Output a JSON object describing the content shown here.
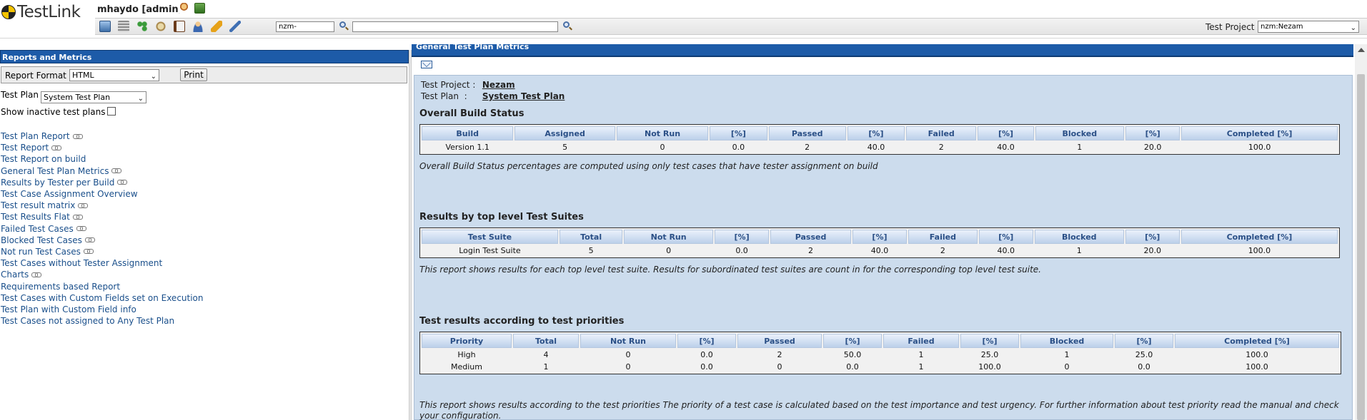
{
  "header": {
    "logo_text": "TestLink",
    "user": "mhaydo [admin]",
    "test_case_id_value": "nzm-",
    "search_value": "",
    "test_project_label": "Test Project",
    "test_project_selected": "nzm:Nezam"
  },
  "left": {
    "title": "Reports and Metrics",
    "report_format_label": "Report Format",
    "report_format_selected": "HTML",
    "print_label": "Print",
    "test_plan_label": "Test Plan",
    "test_plan_selected": "System Test Plan",
    "show_inactive_label": "Show inactive test plans",
    "links": [
      {
        "label": "Test Plan Report",
        "chain": true
      },
      {
        "label": "Test Report",
        "chain": true
      },
      {
        "label": "Test Report on build",
        "chain": false
      },
      {
        "label": "General Test Plan Metrics",
        "chain": true
      },
      {
        "label": "Results by Tester per Build",
        "chain": true
      },
      {
        "label": "Test Case Assignment Overview",
        "chain": false
      },
      {
        "label": "Test result matrix",
        "chain": true
      },
      {
        "label": "Test Results Flat",
        "chain": true
      },
      {
        "label": "Failed Test Cases",
        "chain": true
      },
      {
        "label": "Blocked Test Cases",
        "chain": true
      },
      {
        "label": "Not run Test Cases",
        "chain": true
      },
      {
        "label": "Test Cases without Tester Assignment",
        "chain": false
      },
      {
        "label": "Charts",
        "chain": true
      },
      {
        "label": "Requirements based Report",
        "chain": false
      },
      {
        "label": "Test Cases with Custom Fields set on Execution",
        "chain": false
      },
      {
        "label": "Test Plan with Custom Field info",
        "chain": false
      },
      {
        "label": "Test Cases not assigned to Any Test Plan",
        "chain": false
      }
    ]
  },
  "right": {
    "title": "General Test Plan Metrics",
    "project_label": "Test Project",
    "project_value": "Nezam",
    "plan_label": "Test Plan",
    "plan_value": "System Test Plan",
    "build_section": {
      "heading": "Overall Build Status",
      "columns": [
        "Build",
        "Assigned",
        "Not Run",
        "[%]",
        "Passed",
        "[%]",
        "Failed",
        "[%]",
        "Blocked",
        "[%]",
        "Completed [%]"
      ],
      "rows": [
        [
          "Version 1.1",
          "5",
          "0",
          "0.0",
          "2",
          "40.0",
          "2",
          "40.0",
          "1",
          "20.0",
          "100.0"
        ]
      ],
      "note": "Overall Build Status percentages are computed using only test cases that have tester assignment on build"
    },
    "suite_section": {
      "heading": "Results by top level Test Suites",
      "columns": [
        "Test Suite",
        "Total",
        "Not Run",
        "[%]",
        "Passed",
        "[%]",
        "Failed",
        "[%]",
        "Blocked",
        "[%]",
        "Completed [%]"
      ],
      "rows": [
        [
          "Login Test Suite",
          "5",
          "0",
          "0.0",
          "2",
          "40.0",
          "2",
          "40.0",
          "1",
          "20.0",
          "100.0"
        ]
      ],
      "note": "This report shows results for each top level test suite. Results for subordinated test suites are count in for the corresponding top level test suite."
    },
    "priority_section": {
      "heading": "Test results according to test priorities",
      "columns": [
        "Priority",
        "Total",
        "Not Run",
        "[%]",
        "Passed",
        "[%]",
        "Failed",
        "[%]",
        "Blocked",
        "[%]",
        "Completed [%]"
      ],
      "rows": [
        [
          "High",
          "4",
          "0",
          "0.0",
          "2",
          "50.0",
          "1",
          "25.0",
          "1",
          "25.0",
          "100.0"
        ],
        [
          "Medium",
          "1",
          "0",
          "0.0",
          "0",
          "0.0",
          "1",
          "100.0",
          "0",
          "0.0",
          "100.0"
        ]
      ],
      "note": "This report shows results according to the test priorities The priority of a test case is calculated based on the test importance and test urgency. For further information about test priority read the manual and check your configuration."
    }
  }
}
